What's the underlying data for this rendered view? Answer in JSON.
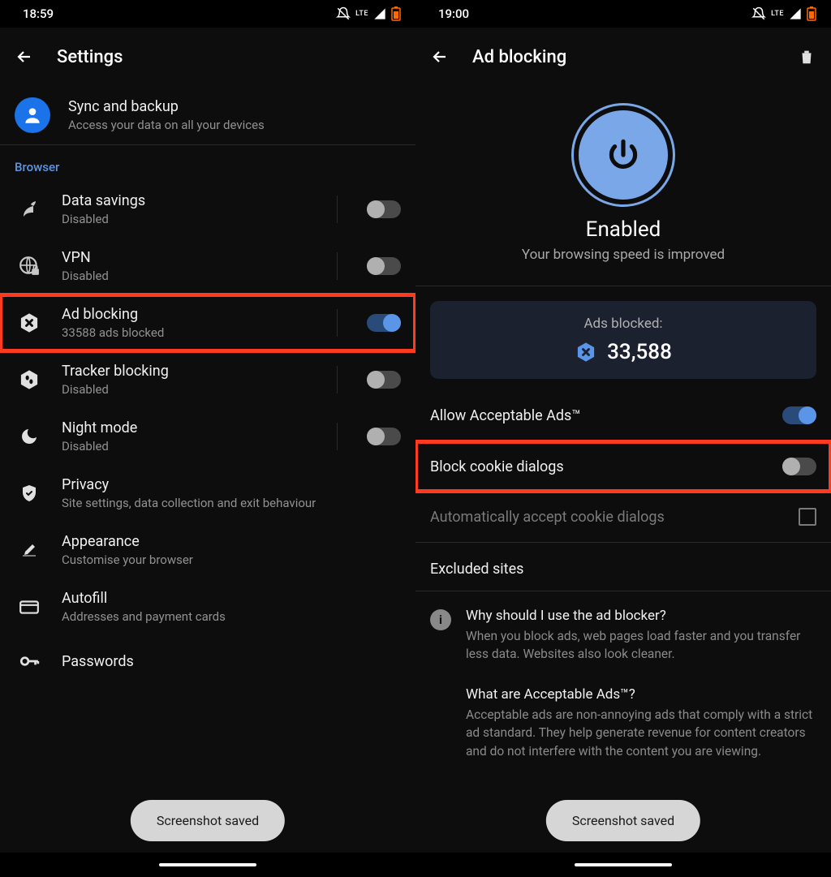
{
  "left": {
    "status": {
      "time": "18:59",
      "net": "LTE"
    },
    "title": "Settings",
    "sync": {
      "title": "Sync and backup",
      "sub": "Access your data on all your devices"
    },
    "section": "Browser",
    "items": [
      {
        "title": "Data savings",
        "sub": "Disabled",
        "on": false
      },
      {
        "title": "VPN",
        "sub": "Disabled",
        "on": false
      },
      {
        "title": "Ad blocking",
        "sub": "33588 ads blocked",
        "on": true
      },
      {
        "title": "Tracker blocking",
        "sub": "Disabled",
        "on": false
      },
      {
        "title": "Night mode",
        "sub": "Disabled",
        "on": false
      },
      {
        "title": "Privacy",
        "sub": "Site settings, data collection and exit behaviour"
      },
      {
        "title": "Appearance",
        "sub": "Customise your browser"
      },
      {
        "title": "Autofill",
        "sub": "Addresses and payment cards"
      },
      {
        "title": "Passwords",
        "sub": ""
      }
    ],
    "toast": "Screenshot saved"
  },
  "right": {
    "status": {
      "time": "19:00",
      "net": "LTE"
    },
    "title": "Ad blocking",
    "hero": {
      "status": "Enabled",
      "sub": "Your browsing speed is improved"
    },
    "stats": {
      "label": "Ads blocked:",
      "value": "33,588"
    },
    "opts": [
      {
        "label": "Allow Acceptable Ads™",
        "on": true,
        "type": "toggle"
      },
      {
        "label": "Block cookie dialogs",
        "on": false,
        "type": "toggle"
      },
      {
        "label": "Automatically accept cookie dialogs",
        "on": false,
        "type": "check",
        "dim": true
      }
    ],
    "excluded": "Excluded sites",
    "info": [
      {
        "title": "Why should I use the ad blocker?",
        "body": "When you block ads, web pages load faster and you transfer less data. Websites also look cleaner."
      },
      {
        "title": "What are Acceptable Ads™?",
        "body": "Acceptable ads are non-annoying ads that comply with a strict ad standard. They help generate revenue for content creators and do not interfere with the content you are viewing."
      }
    ],
    "toast": "Screenshot saved"
  }
}
